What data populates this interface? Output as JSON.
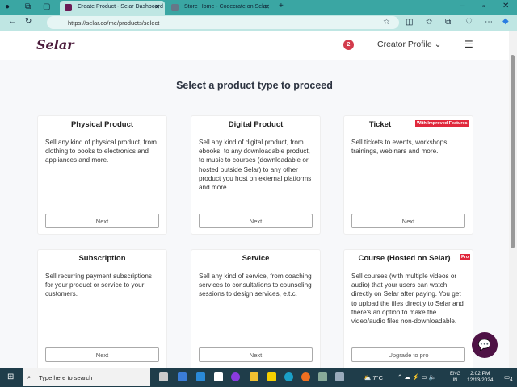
{
  "browser": {
    "tabs": [
      {
        "title": "Create Product - Selar Dashboard",
        "active": true
      },
      {
        "title": "Store Home - Codecrate on Selar",
        "active": false
      }
    ],
    "url": "https://selar.co/me/products/select"
  },
  "header": {
    "logo": "Selar",
    "notification_count": "2",
    "profile_label": "Creator Profile"
  },
  "page_title": "Select a product type to proceed",
  "cards": [
    {
      "title": "Physical Product",
      "description": "Sell any kind of physical product, from clothing to books to electronics and appliances and more.",
      "button": "Next"
    },
    {
      "title": "Digital Product",
      "description": "Sell any kind of digital product, from ebooks, to any downloadable product, to music to courses (downloadable or hosted outside Selar) to any other product you host on external platforms and more.",
      "button": "Next"
    },
    {
      "title": "Ticket",
      "badge": "With Improved Features",
      "description": "Sell tickets to events, workshops, trainings, webinars and more.",
      "button": "Next"
    },
    {
      "title": "Subscription",
      "description": "Sell recurring payment subscriptions for your product or service to your customers.",
      "button": "Next"
    },
    {
      "title": "Service",
      "description": "Sell any kind of service, from coaching services to consultations to counseling sessions to design services, e.t.c.",
      "button": "Next"
    },
    {
      "title": "Course (Hosted on Selar)",
      "badge": "Pro",
      "description": "Sell courses (with multiple videos or audio) that your users can watch directly on Selar after paying. You get to upload the files directly to Selar and there's an option to make the video/audio files non-downloadable.",
      "button": "Upgrade to pro"
    }
  ],
  "taskbar": {
    "search_placeholder": "Type here to search",
    "weather": "7°C",
    "lang": "ENG",
    "region": "IN",
    "time": "2:02 PM",
    "date": "12/13/2024",
    "notifications": "4"
  }
}
